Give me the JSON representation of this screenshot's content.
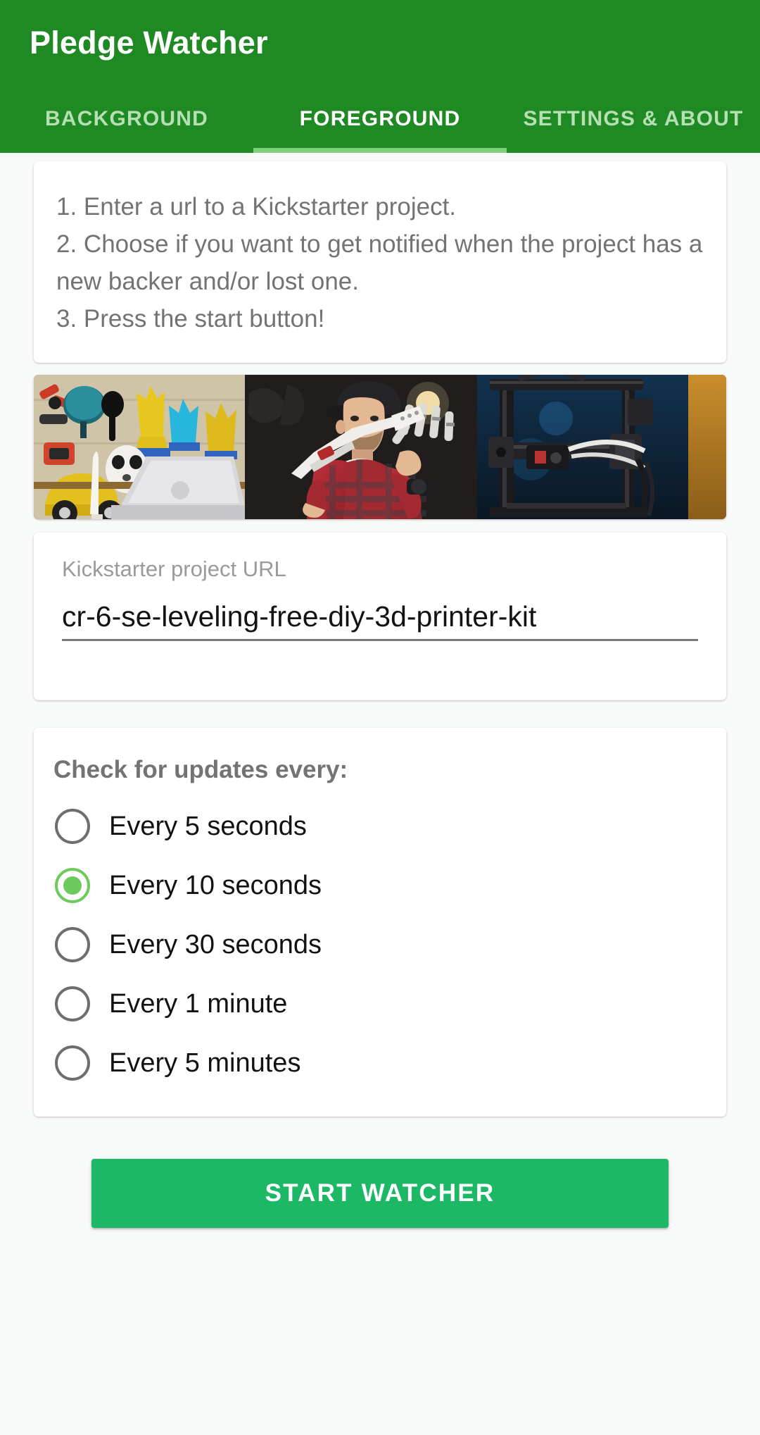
{
  "app": {
    "title": "Pledge Watcher",
    "header_color": "#1F8A24",
    "accent_color": "#1CB865",
    "tab_indicator_color": "#7CD17A",
    "radio_selected_color": "#6DCB5C",
    "page_background": "#F8F9F9"
  },
  "tabs": [
    {
      "label": "BACKGROUND",
      "active": false
    },
    {
      "label": "FOREGROUND",
      "active": true
    },
    {
      "label": "SETTINGS & ABOUT",
      "active": false
    }
  ],
  "instructions": {
    "text": "1. Enter a url to a Kickstarter project.\n2. Choose if you want to get notified when the project has a new backer and/or lost one.\n3. Press the start button!"
  },
  "hero": {
    "alt": "Man holding a 3d-printed robotic hand next to a 3d printer"
  },
  "url_field": {
    "label": "Kickstarter project URL",
    "value": "cr-6-se-leveling-free-diy-3d-printer-kit",
    "placeholder": "Kickstarter project URL"
  },
  "interval": {
    "title": "Check for updates every:",
    "selected_index": 1,
    "options": [
      {
        "label": "Every 5 seconds"
      },
      {
        "label": "Every 10 seconds"
      },
      {
        "label": "Every 30 seconds"
      },
      {
        "label": "Every 1 minute"
      },
      {
        "label": "Every 5 minutes"
      }
    ]
  },
  "actions": {
    "start_label": "START WATCHER"
  }
}
